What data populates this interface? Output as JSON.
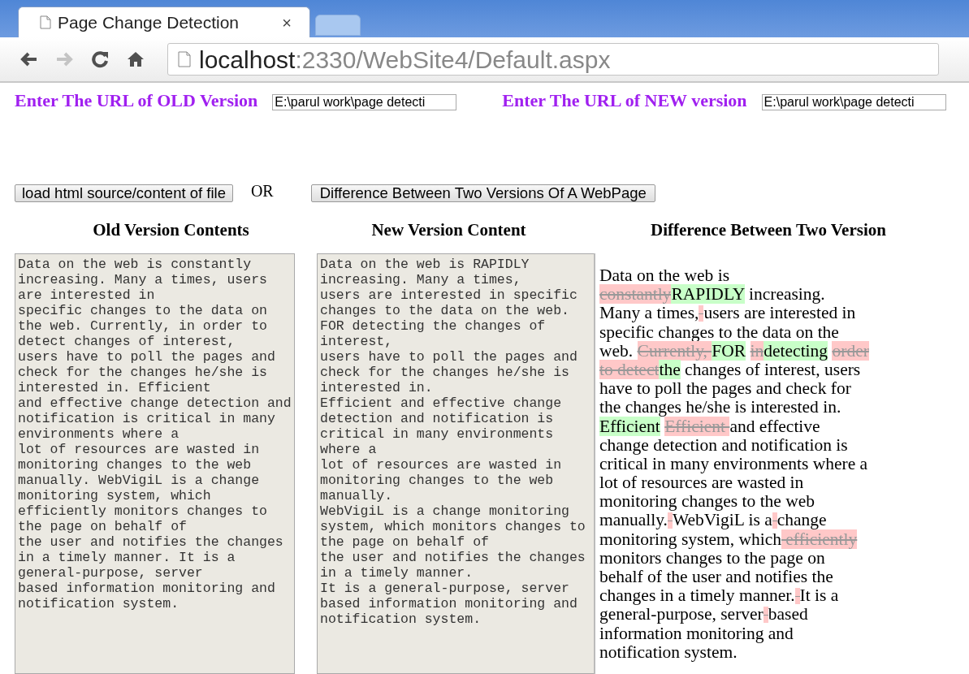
{
  "browser": {
    "tab": {
      "title": "Page Change Detection",
      "close": "×"
    },
    "nav": [
      {
        "kind": "back",
        "disabled": false
      },
      {
        "kind": "forward",
        "disabled": true
      },
      {
        "kind": "reload",
        "disabled": false
      },
      {
        "kind": "home",
        "disabled": false
      }
    ],
    "address": {
      "host": "localhost",
      "path": ":2330/WebSite4/Default.aspx"
    }
  },
  "url_fields": [
    {
      "label": "Enter The URL of OLD Version",
      "value": "E:\\parul work\\page detecti"
    },
    {
      "label": "Enter The URL of NEW version",
      "value": "E:\\parul work\\page detecti"
    }
  ],
  "actions": {
    "load_button": "load html source/content of file",
    "or_text": "OR",
    "diff_button": "Difference Between Two Versions Of A WebPage"
  },
  "old_version": {
    "heading": "Old Version Contents",
    "text": "Data on the web is constantly increasing. Many a times, users are interested in\nspecific changes to the data on the web. Currently, in order to detect changes of interest,\nusers have to poll the pages and check for the changes he/she is interested in. Efficient\nand effective change detection and notification is critical in many environments where a\nlot of resources are wasted in monitoring changes to the web manually. WebVigiL is a change monitoring system, which efficiently monitors changes to the page on behalf of\nthe user and notifies the changes in a timely manner. It is a general-purpose, server\nbased information monitoring and notification system."
  },
  "new_version": {
    "heading": "New Version Content",
    "text": "Data on the web is RAPIDLY increasing. Many a times,\nusers are interested in specific changes to the data on the web. FOR detecting the changes of interest,\nusers have to poll the pages and check for the changes he/she is interested in.\nEfficient and effective change detection and notification is critical in many environments where a\nlot of resources are wasted in monitoring changes to the web manually.\nWebVigiL is a change monitoring system, which monitors changes to the page on behalf of\nthe user and notifies the changes in a timely manner.\nIt is a general-purpose, server based information monitoring and notification system."
  },
  "difference": {
    "heading": "Difference Between Two Version",
    "lines": [
      {
        "segments": [
          {
            "kind": "same",
            "text": "Data on the web is"
          }
        ]
      },
      {
        "segments": [
          {
            "kind": "deleted",
            "text": "constantly"
          },
          {
            "kind": "inserted",
            "text": "RAPIDLY"
          },
          {
            "kind": "same",
            "text": " increasing."
          }
        ]
      },
      {
        "segments": [
          {
            "kind": "same",
            "text": "Many a times,"
          },
          {
            "kind": "deleted_space"
          },
          {
            "kind": "same",
            "text": "users are interested in"
          }
        ]
      },
      {
        "segments": [
          {
            "kind": "same",
            "text": "specific changes to the data on the"
          }
        ]
      },
      {
        "segments": [
          {
            "kind": "same",
            "text": "web. "
          },
          {
            "kind": "deleted",
            "text": "Currently, "
          },
          {
            "kind": "inserted",
            "text": "FOR"
          },
          {
            "kind": "space"
          },
          {
            "kind": "deleted",
            "text": "in"
          },
          {
            "kind": "inserted",
            "text": "detecting"
          },
          {
            "kind": "space"
          },
          {
            "kind": "deleted",
            "text": "order"
          }
        ]
      },
      {
        "segments": [
          {
            "kind": "deleted",
            "text": "to detect"
          },
          {
            "kind": "inserted",
            "text": "the"
          },
          {
            "kind": "same",
            "text": " changes of interest, users"
          }
        ]
      },
      {
        "segments": [
          {
            "kind": "same",
            "text": "have to poll the pages and check for"
          }
        ]
      },
      {
        "segments": [
          {
            "kind": "same",
            "text": "the changes he/she is interested in."
          }
        ]
      },
      {
        "segments": [
          {
            "kind": "inserted",
            "text": "Efficient"
          },
          {
            "kind": "space"
          },
          {
            "kind": "deleted",
            "text": "Efficient "
          },
          {
            "kind": "same",
            "text": "and effective"
          }
        ]
      },
      {
        "segments": [
          {
            "kind": "same",
            "text": "change detection and notification is"
          }
        ]
      },
      {
        "segments": [
          {
            "kind": "same",
            "text": "critical in many environments where a"
          }
        ]
      },
      {
        "segments": [
          {
            "kind": "same",
            "text": "lot of resources are wasted in"
          }
        ]
      },
      {
        "segments": [
          {
            "kind": "same",
            "text": "monitoring changes to the web"
          }
        ]
      },
      {
        "segments": [
          {
            "kind": "same",
            "text": "manually."
          },
          {
            "kind": "deleted_space"
          },
          {
            "kind": "same",
            "text": "WebVigiL is a"
          },
          {
            "kind": "deleted_space"
          },
          {
            "kind": "same",
            "text": "change"
          }
        ]
      },
      {
        "segments": [
          {
            "kind": "same",
            "text": "monitoring system, which"
          },
          {
            "kind": "deleted",
            "text": " efficiently"
          }
        ]
      },
      {
        "segments": [
          {
            "kind": "same",
            "text": "monitors changes to the page on"
          }
        ]
      },
      {
        "segments": [
          {
            "kind": "same",
            "text": "behalf of the user and notifies the"
          }
        ]
      },
      {
        "segments": [
          {
            "kind": "same",
            "text": "changes in a timely manner."
          },
          {
            "kind": "deleted_space"
          },
          {
            "kind": "same",
            "text": "It is a"
          }
        ]
      },
      {
        "segments": [
          {
            "kind": "same",
            "text": "general-purpose, server"
          },
          {
            "kind": "deleted_space"
          },
          {
            "kind": "same",
            "text": "based"
          }
        ]
      },
      {
        "segments": [
          {
            "kind": "same",
            "text": "information monitoring and"
          }
        ]
      },
      {
        "segments": [
          {
            "kind": "same",
            "text": "notification system."
          }
        ]
      }
    ]
  }
}
